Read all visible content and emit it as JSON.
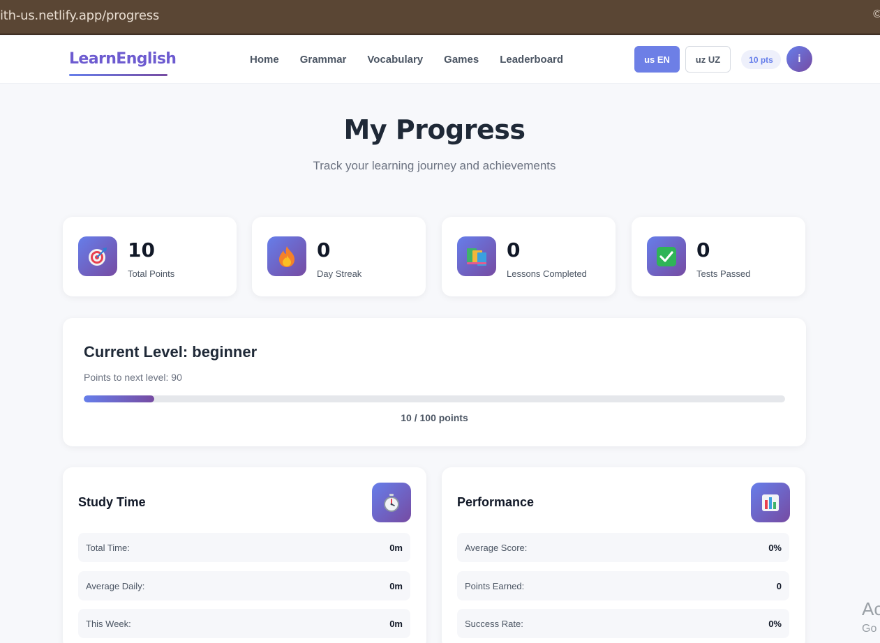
{
  "browser": {
    "url": "ith-us.netlify.app/progress",
    "edge_glyph": "©"
  },
  "nav": {
    "logo": "LearnEnglish",
    "links": [
      "Home",
      "Grammar",
      "Vocabulary",
      "Games",
      "Leaderboard"
    ],
    "lang_en": "us EN",
    "lang_uz": "uz UZ",
    "points_badge": "10 pts",
    "avatar_initial": "i"
  },
  "header": {
    "title": "My Progress",
    "subtitle": "Track your learning journey and achievements"
  },
  "stats": [
    {
      "value": "10",
      "label": "Total Points",
      "icon": "target-icon"
    },
    {
      "value": "0",
      "label": "Day Streak",
      "icon": "fire-icon"
    },
    {
      "value": "0",
      "label": "Lessons Completed",
      "icon": "books-icon"
    },
    {
      "value": "0",
      "label": "Tests Passed",
      "icon": "check-icon"
    }
  ],
  "level": {
    "title": "Current Level: beginner",
    "points_to_next": "Points to next level: 90",
    "progress_text": "10 / 100 points",
    "progress_fraction": 0.1
  },
  "study_time": {
    "title": "Study Time",
    "icon": "stopwatch-icon",
    "rows": [
      {
        "label": "Total Time:",
        "value": "0m"
      },
      {
        "label": "Average Daily:",
        "value": "0m"
      },
      {
        "label": "This Week:",
        "value": "0m"
      }
    ]
  },
  "performance": {
    "title": "Performance",
    "icon": "bar-chart-icon",
    "rows": [
      {
        "label": "Average Score:",
        "value": "0%"
      },
      {
        "label": "Points Earned:",
        "value": "0"
      },
      {
        "label": "Success Rate:",
        "value": "0%"
      }
    ]
  },
  "watermark": {
    "line1": "Ac",
    "line2": "Go"
  },
  "colors": {
    "accent": "#667eea",
    "accent_dark": "#764ba2",
    "browser_bar": "#5a4634"
  }
}
